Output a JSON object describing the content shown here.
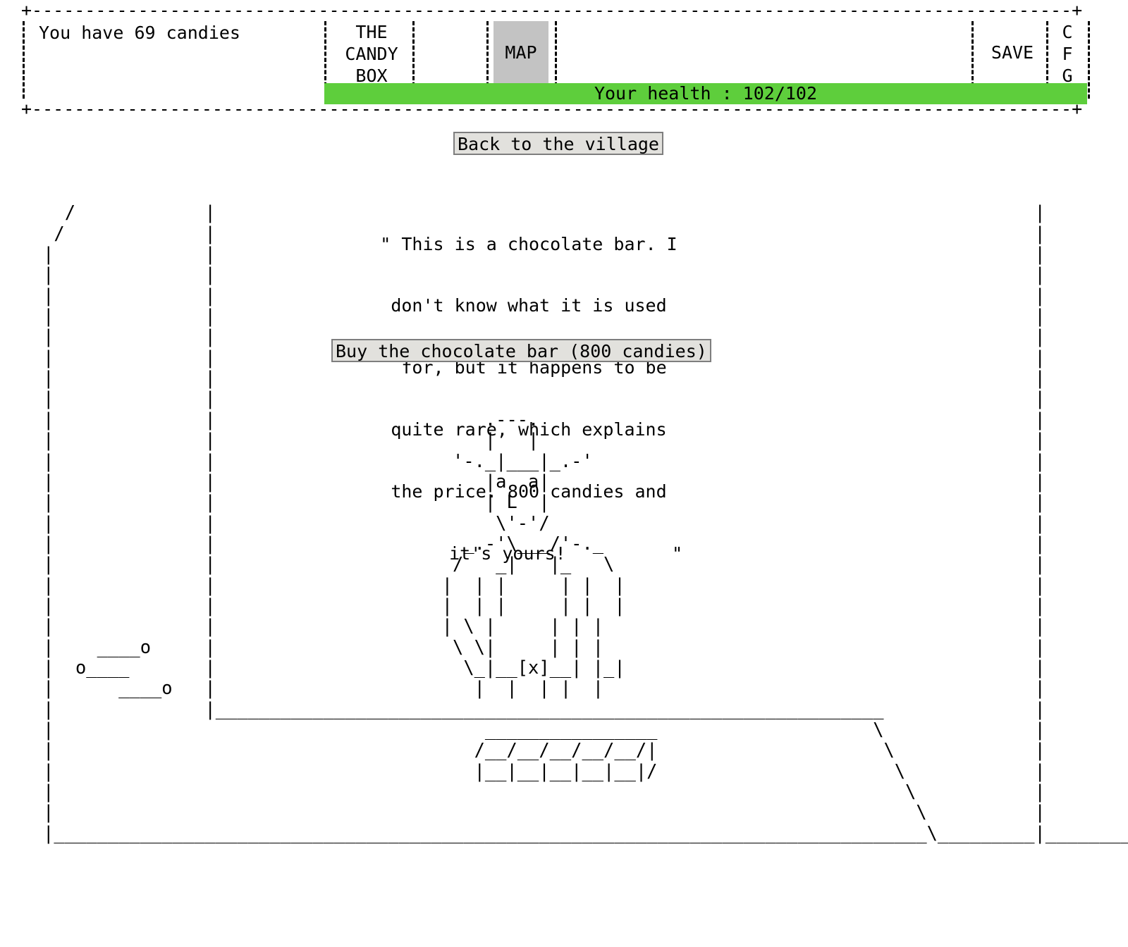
{
  "header": {
    "candies_text": "You have 69 candies",
    "frame_top": "+--------------------------------------------------------------------------------------------------+",
    "frame_bottom": "+--------------------------------------------------------------------------------------------------+",
    "tabs": [
      {
        "id": "candybox",
        "lines": [
          "THE",
          "CANDY",
          "BOX"
        ],
        "selected": false
      },
      {
        "id": "map",
        "lines": [
          "MAP"
        ],
        "selected": true
      },
      {
        "id": "save",
        "lines": [
          "SAVE"
        ],
        "selected": false
      },
      {
        "id": "cfg",
        "lines": [
          "C",
          "F",
          "G"
        ],
        "selected": false
      }
    ],
    "health_label": "Your health : 102/102",
    "health_current": 102,
    "health_max": 102,
    "health_color": "#5ece3c",
    "selected_tab_color": "#c3c3c3"
  },
  "buttons": {
    "back_to_village": "Back to the village",
    "buy_chocolate_bar": "Buy the chocolate bar (800 candies)"
  },
  "merchant_quote": {
    "lines": [
      "\" This is a chocolate bar. I",
      "don't know what it is used",
      " for, but it happens to be",
      "quite rare, which explains",
      "the price. 800 candies and",
      "       it's yours!          \""
    ],
    "price": 800,
    "item": "chocolate bar"
  },
  "scene": {
    "art": "      /            |                                                                            |        \\\n     /             |                                                                            |         \\\n    |              |                                                                            |          |\n    |              |                                                                            |          |\n    |              |                                                                            |          |\n    |              |                                                                            |          |\n    |              |                                                                            |          |\n    |              |                                                                            |          |\n    |              |                                                                            |          |\n    |              |                                                                            |          |\n    |              |                         .---.                                              |          |\n    |              |                         |   |                                              |          |\n    |              |                      '-._|___|_.-'                                         |          |\n    |              |                         |a  a|                                             |          |\n    |              |                         | L  |                                             |          |\n    |              |                          \\'-'/                                             |          |\n    |              |                       _.-'\\___/'-._                                        |          |\n    |              |                      /   _|   |_   \\                                       |          |\n    |              |                     |  | |     | |  |                                      |          |\n    |              |                     |  | |     | |  |                                      |          |\n    |              |                     | \\ |     | | |                                        |          |\n    |    ____o     |                      \\ \\|     | | |                                        |          |\n    |  o____       |                       \\_|__[x]__| |_|                                      |          |\n    |      ____o   |                        |  |  | |  |                                        |          |\n    |              |______________________________________________________________              |          |\n    |                                        ________________                    \\              |          |\n    |                                       /__/__/__/__/__/|                     \\             |          |\n    |                                       |__|__|__|__|__|/                      \\            |          |\n    |                                                                               \\           |          |\n    |                                                                                \\          |          |\n    |_________________________________________________________________________________\\_________|__________|\n"
  },
  "colors": {
    "page_background": "#ffffff",
    "text": "#000000",
    "button_face": "#e2e1dd",
    "button_border": "#7e7e7e",
    "health_green": "#5ece3c",
    "tab_selected_gray": "#c3c3c3"
  }
}
